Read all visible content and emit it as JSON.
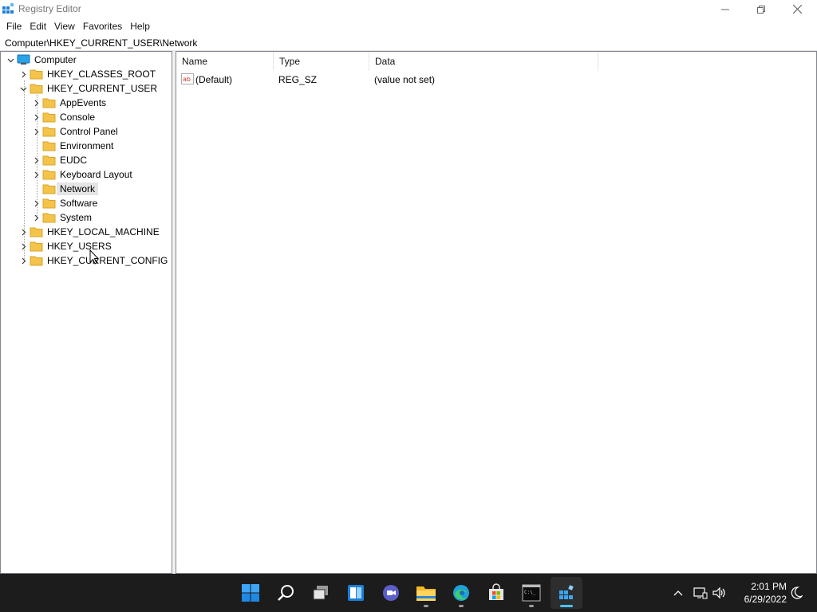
{
  "window": {
    "title": "Registry Editor",
    "icon": "regedit-icon"
  },
  "menu": [
    "File",
    "Edit",
    "View",
    "Favorites",
    "Help"
  ],
  "address": "Computer\\HKEY_CURRENT_USER\\Network",
  "tree": {
    "root": "Computer",
    "hives": [
      "HKEY_CLASSES_ROOT",
      "HKEY_CURRENT_USER",
      "HKEY_LOCAL_MACHINE",
      "HKEY_USERS",
      "HKEY_CURRENT_CONFIG"
    ],
    "current_user_children": [
      "AppEvents",
      "Console",
      "Control Panel",
      "Environment",
      "EUDC",
      "Keyboard Layout",
      "Network",
      "Software",
      "System"
    ],
    "selected": "Network"
  },
  "list": {
    "columns": [
      "Name",
      "Type",
      "Data"
    ],
    "rows": [
      {
        "name": "(Default)",
        "type": "REG_SZ",
        "data": "(value not set)",
        "icon": "string-value-icon"
      }
    ]
  },
  "taskbar": {
    "apps": [
      "start-icon",
      "search-icon",
      "task-view-icon",
      "widgets-icon",
      "chat-icon",
      "file-explorer-icon",
      "edge-icon",
      "store-icon",
      "terminal-icon",
      "regedit-icon"
    ],
    "active_app": "regedit-icon",
    "clock_time": "2:01 PM",
    "clock_date": "6/29/2022"
  },
  "colors": {
    "taskbar_bg": "#1c1c1c",
    "accent": "#4cc2ff",
    "folder": "#f3c34a",
    "selection": "#e5e5e5"
  }
}
